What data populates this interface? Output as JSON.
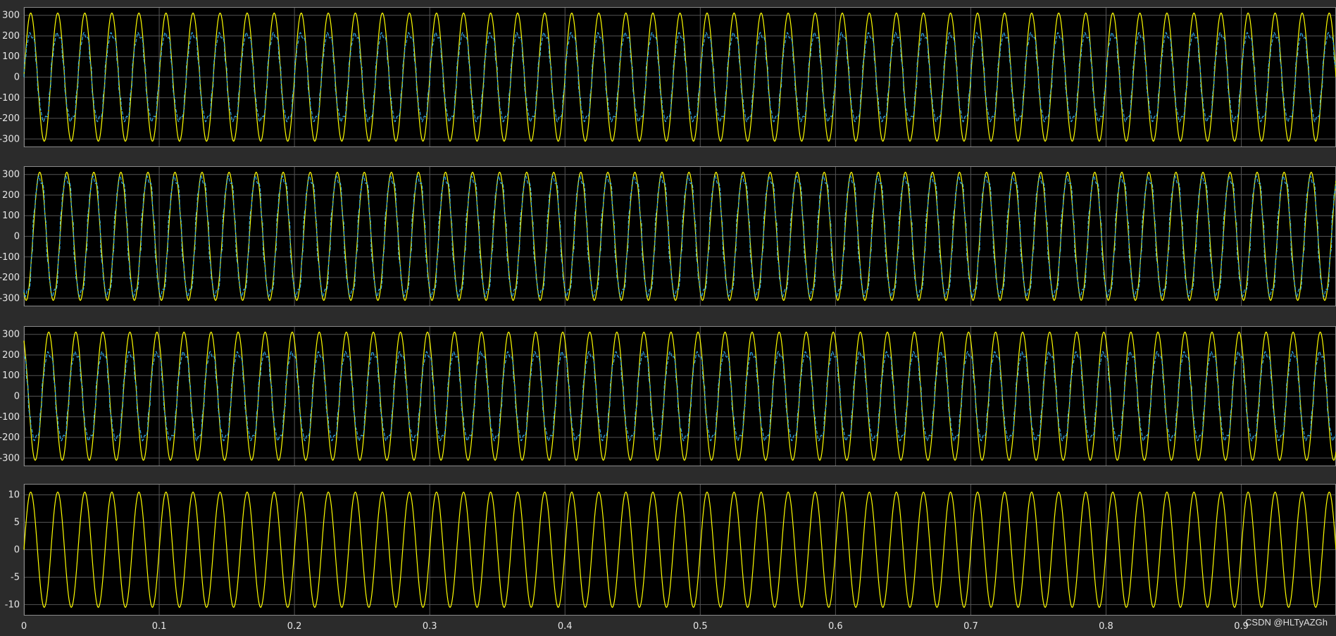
{
  "watermark": "CSDN @HLTyAZGh",
  "colors": {
    "figure_bg": "#2b2b2b",
    "axes_bg": "#000000",
    "grid": "#555555",
    "axis_frame": "#8a8a8a",
    "tick_text": "#e6e6e6",
    "series_yellow": "#ffff00",
    "series_blue": "#2fa7e6"
  },
  "chart_data": [
    {
      "type": "line",
      "grid": true,
      "xlim": [
        0,
        0.97
      ],
      "ylim": [
        -340,
        340
      ],
      "yticks": [
        -300,
        -200,
        -100,
        0,
        100,
        200,
        300
      ],
      "xticks": [
        0,
        0.1,
        0.2,
        0.3,
        0.4,
        0.5,
        0.6,
        0.7,
        0.8,
        0.9
      ],
      "show_xticklabels": false,
      "series": [
        {
          "color": "#ffff00",
          "waveform": "sine",
          "amplitude": 311,
          "frequency_hz": 50,
          "phase_deg": 0
        },
        {
          "color": "#2fa7e6",
          "waveform": "six-step",
          "amplitude": 207,
          "frequency_hz": 50,
          "phase_deg": 0
        }
      ]
    },
    {
      "type": "line",
      "grid": true,
      "xlim": [
        0,
        0.97
      ],
      "ylim": [
        -340,
        340
      ],
      "yticks": [
        -300,
        -200,
        -100,
        0,
        100,
        200,
        300
      ],
      "xticks": [
        0,
        0.1,
        0.2,
        0.3,
        0.4,
        0.5,
        0.6,
        0.7,
        0.8,
        0.9
      ],
      "show_xticklabels": false,
      "series": [
        {
          "color": "#ffff00",
          "waveform": "sine",
          "amplitude": 311,
          "frequency_hz": 50,
          "phase_deg": -120
        },
        {
          "color": "#2fa7e6",
          "waveform": "six-step",
          "amplitude": 280,
          "frequency_hz": 50,
          "phase_deg": -120
        }
      ]
    },
    {
      "type": "line",
      "grid": true,
      "xlim": [
        0,
        0.97
      ],
      "ylim": [
        -340,
        340
      ],
      "yticks": [
        -300,
        -200,
        -100,
        0,
        100,
        200,
        300
      ],
      "xticks": [
        0,
        0.1,
        0.2,
        0.3,
        0.4,
        0.5,
        0.6,
        0.7,
        0.8,
        0.9
      ],
      "show_xticklabels": false,
      "series": [
        {
          "color": "#ffff00",
          "waveform": "sine",
          "amplitude": 311,
          "frequency_hz": 50,
          "phase_deg": 120
        },
        {
          "color": "#2fa7e6",
          "waveform": "six-step",
          "amplitude": 207,
          "frequency_hz": 50,
          "phase_deg": 120
        }
      ]
    },
    {
      "type": "line",
      "grid": true,
      "xlim": [
        0,
        0.97
      ],
      "ylim": [
        -12,
        12
      ],
      "yticks": [
        -10,
        -5,
        0,
        5,
        10
      ],
      "xticks": [
        0,
        0.1,
        0.2,
        0.3,
        0.4,
        0.5,
        0.6,
        0.7,
        0.8,
        0.9
      ],
      "show_xticklabels": true,
      "series": [
        {
          "color": "#ffff00",
          "waveform": "sine",
          "amplitude": 10.5,
          "frequency_hz": 50,
          "phase_deg": 0
        }
      ]
    }
  ]
}
